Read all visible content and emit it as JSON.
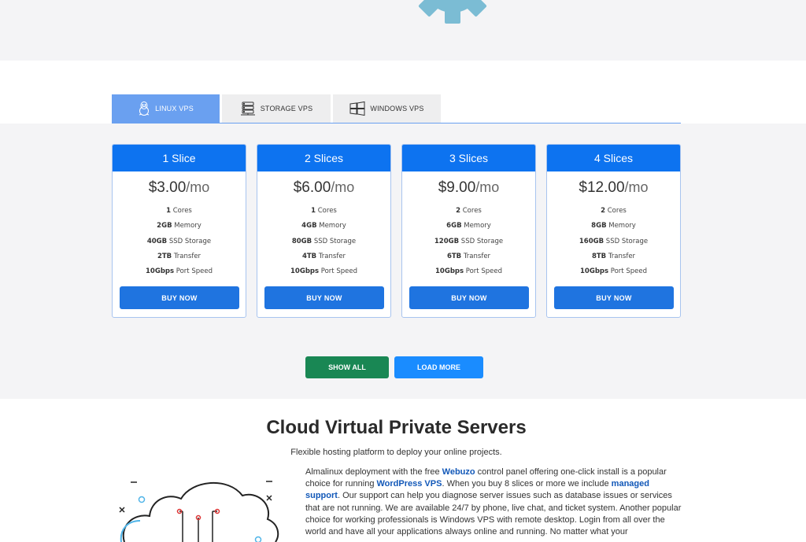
{
  "tabs": [
    {
      "label": "LINUX VPS",
      "icon": "linux-penguin-icon",
      "active": true
    },
    {
      "label": "STORAGE VPS",
      "icon": "storage-server-icon",
      "active": false
    },
    {
      "label": "WINDOWS VPS",
      "icon": "windows-logo-icon",
      "active": false
    }
  ],
  "plans": [
    {
      "title": "1 Slice",
      "price": "$3.00",
      "unit": "/mo",
      "features": [
        [
          "1",
          " Cores"
        ],
        [
          "2GB",
          " Memory"
        ],
        [
          "40GB",
          " SSD Storage"
        ],
        [
          "2TB",
          " Transfer"
        ],
        [
          "10Gbps",
          " Port Speed"
        ]
      ],
      "button": "BUY NOW"
    },
    {
      "title": "2 Slices",
      "price": "$6.00",
      "unit": "/mo",
      "features": [
        [
          "1",
          " Cores"
        ],
        [
          "4GB",
          " Memory"
        ],
        [
          "80GB",
          " SSD Storage"
        ],
        [
          "4TB",
          " Transfer"
        ],
        [
          "10Gbps",
          " Port Speed"
        ]
      ],
      "button": "BUY NOW"
    },
    {
      "title": "3 Slices",
      "price": "$9.00",
      "unit": "/mo",
      "features": [
        [
          "2",
          " Cores"
        ],
        [
          "6GB",
          " Memory"
        ],
        [
          "120GB",
          " SSD Storage"
        ],
        [
          "6TB",
          " Transfer"
        ],
        [
          "10Gbps",
          " Port Speed"
        ]
      ],
      "button": "BUY NOW"
    },
    {
      "title": "4 Slices",
      "price": "$12.00",
      "unit": "/mo",
      "features": [
        [
          "2",
          " Cores"
        ],
        [
          "8GB",
          " Memory"
        ],
        [
          "160GB",
          " SSD Storage"
        ],
        [
          "8TB",
          " Transfer"
        ],
        [
          "10Gbps",
          " Port Speed"
        ]
      ],
      "button": "BUY NOW"
    }
  ],
  "actions": {
    "show_all": "SHOW ALL",
    "load_more": "LOAD MORE"
  },
  "section": {
    "heading": "Cloud Virtual Private Servers",
    "subtitle": "Flexible hosting platform to deploy your online projects.",
    "para_1": "Almalinux deployment with the free ",
    "link_webuzo": "Webuzo",
    "para_2": " control panel offering one-click install is a popular choice for running ",
    "link_wordpress": "WordPress VPS",
    "para_3": ". When you buy 8 slices or more we include ",
    "link_managed": "managed support",
    "para_4": ". Our support can help you diagnose server issues such as database issues or services that are not running. We are available 24/7 by phone, live chat, and ticket system. Another popular choice for working professionals is Windows VPS with remote desktop. Login from all over the world and have all your applications always online and running. No matter what your"
  },
  "colors": {
    "primary": "#0d73f0",
    "tab_active": "#6aa0f0",
    "show_all": "#198754",
    "load_more": "#1a8cff",
    "link": "#1258b8"
  }
}
